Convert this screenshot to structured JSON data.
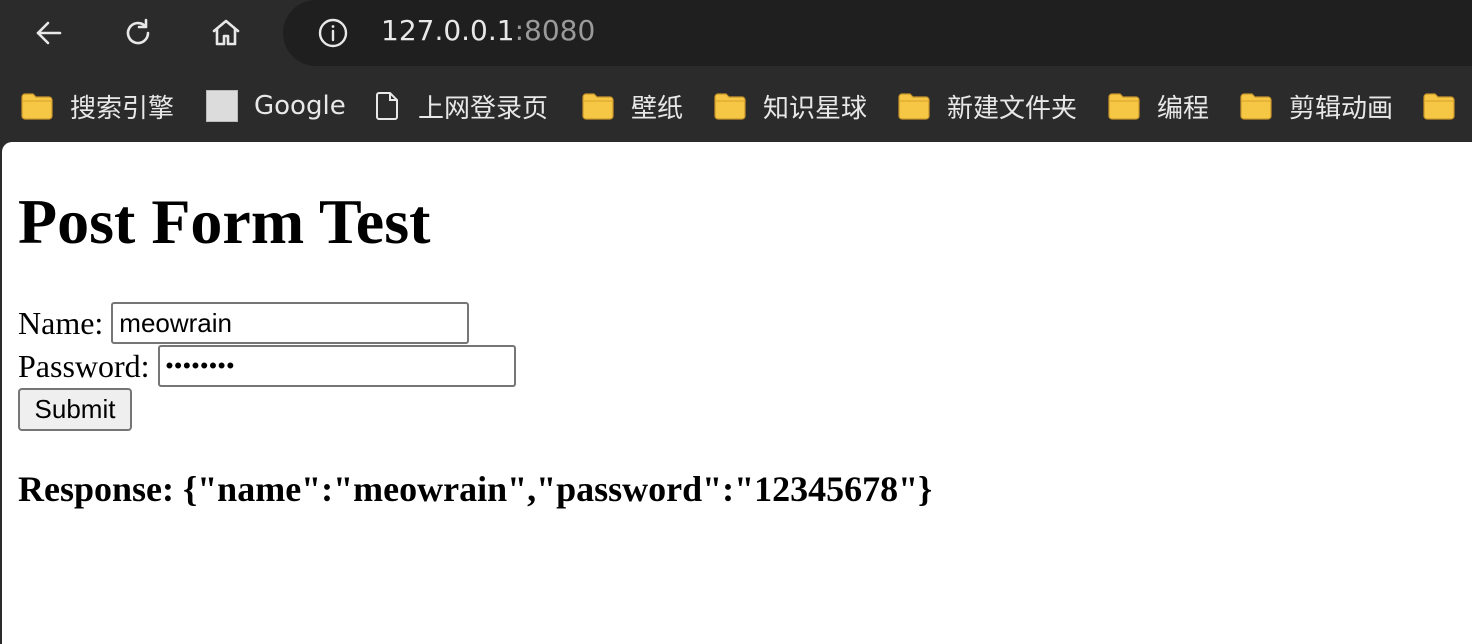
{
  "browser": {
    "url_host": "127.0.0.1",
    "url_port": ":8080"
  },
  "bookmarks": [
    {
      "label": "搜索引擎",
      "icon": "folder-icon"
    },
    {
      "label": "Google",
      "icon": "google-favicon-icon"
    },
    {
      "label": "上网登录页",
      "icon": "page-icon"
    },
    {
      "label": "壁纸",
      "icon": "folder-icon"
    },
    {
      "label": "知识星球",
      "icon": "folder-icon"
    },
    {
      "label": "新建文件夹",
      "icon": "folder-icon"
    },
    {
      "label": "编程",
      "icon": "folder-icon"
    },
    {
      "label": "剪辑动画",
      "icon": "folder-icon"
    },
    {
      "label": "",
      "icon": "folder-icon"
    }
  ],
  "page": {
    "title": "Post Form Test",
    "name_label": "Name:",
    "name_value": "meowrain",
    "password_label": "Password:",
    "password_value": "••••••••",
    "submit_label": "Submit",
    "response_text": "Response: {\"name\":\"meowrain\",\"password\":\"12345678\"}"
  },
  "colors": {
    "toolbar_bg": "#2b2b2b",
    "omnibox_bg": "#1f1f1f",
    "folder_fill": "#f6c744",
    "page_bg": "#ffffff"
  }
}
